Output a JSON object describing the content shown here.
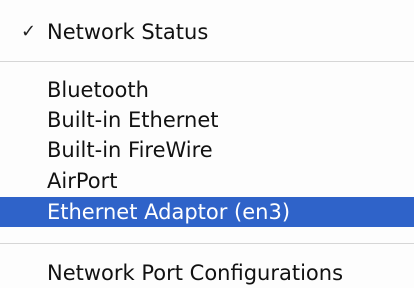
{
  "menu": {
    "items": [
      {
        "label": "Network Status",
        "checked": true,
        "check_glyph": "✓"
      },
      {
        "label": "Bluetooth"
      },
      {
        "label": "Built-in Ethernet"
      },
      {
        "label": "Built-in FireWire"
      },
      {
        "label": "AirPort"
      },
      {
        "label": "Ethernet Adaptor (en3)",
        "highlighted": true
      },
      {
        "label": "Network Port Configurations"
      }
    ],
    "colors": {
      "highlight": "#2f63c9",
      "text": "#111111",
      "highlight_text": "#ffffff",
      "separator": "#d6d6d6"
    }
  }
}
